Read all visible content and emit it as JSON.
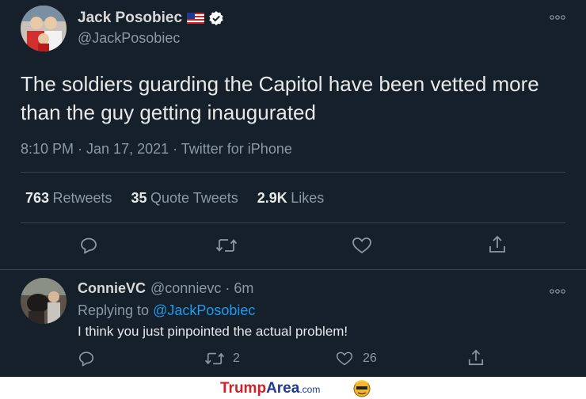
{
  "tweet": {
    "author_name": "Jack Posobiec",
    "author_handle": "@JackPosobiec",
    "text": "The soldiers guarding the Capitol have been vetted more than the guy getting inaugurated",
    "meta": "8:10 PM · Jan 17, 2021 · Twitter for iPhone",
    "stats": {
      "retweets_count": "763",
      "retweets_label": "Retweets",
      "quotes_count": "35",
      "quotes_label": "Quote Tweets",
      "likes_count": "2.9K",
      "likes_label": "Likes"
    },
    "icons": [
      "reply-icon",
      "retweet-icon",
      "like-icon",
      "share-icon",
      "more-icon",
      "verified-icon",
      "us-flag-icon"
    ]
  },
  "reply": {
    "author_name": "ConnieVC",
    "author_handle": "@connievc",
    "time": "· 6m",
    "replying_prefix": "Replying to",
    "replying_handle": "@JackPosobiec",
    "text": "I think you just pinpointed the actual problem!",
    "retweet_count": "2",
    "like_count": "26"
  },
  "watermark": {
    "brand_part1": "Trump",
    "brand_part2": "Area",
    "brand_suffix": ".com"
  },
  "colors": {
    "background": "#15202b",
    "text": "#e7e9ea",
    "secondary": "#8b98a5",
    "link": "#1d9bf0",
    "divider": "#38444d",
    "watermark_red": "#d0202a",
    "watermark_blue": "#1f3a93"
  }
}
